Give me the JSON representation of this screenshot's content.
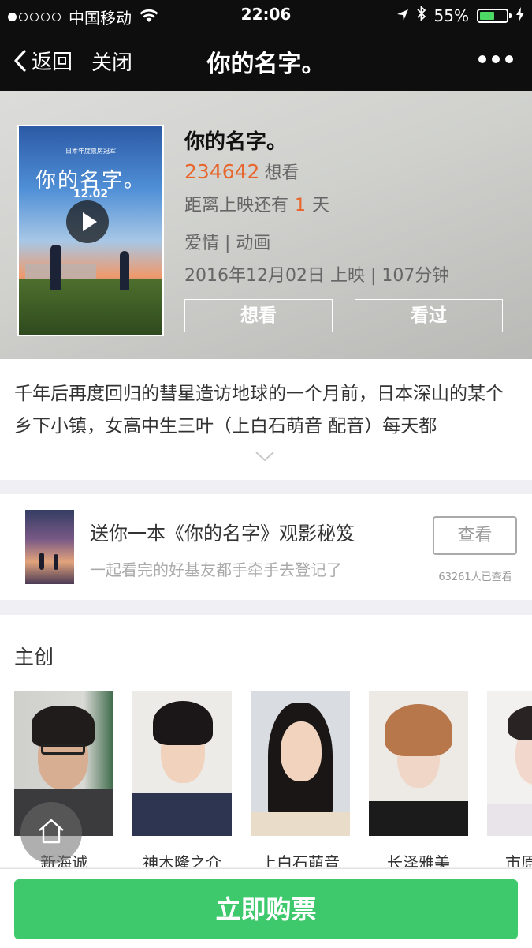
{
  "status_bar": {
    "carrier": "中国移动",
    "time": "22:06",
    "battery": "55%",
    "battery_level": 0.55,
    "signal_bars_filled": 1,
    "signal_bars_total": 5,
    "icons": [
      "wifi-icon",
      "location-arrow-icon",
      "bluetooth-icon",
      "battery-icon",
      "charging-bolt-icon"
    ]
  },
  "nav": {
    "back_label": "返回",
    "close_label": "关闭",
    "title": "你的名字。",
    "more_icon": "more-dots-icon"
  },
  "movie": {
    "title": "你的名字。",
    "wants_count": "234642",
    "wants_label": "想看",
    "release_prefix": "距离上映还有",
    "release_days": "1",
    "release_suffix": "天",
    "genre": "爱情 | 动画",
    "info": "2016年12月02日 上映 | 107分钟",
    "want_button": "想看",
    "seen_button": "看过",
    "poster": {
      "top_text": "日本年度票房冠军",
      "title": "你的名字。",
      "date": "12.02"
    }
  },
  "synopsis": {
    "text": "千年后再度回归的彗星造访地球的一个月前，日本深山的某个乡下小镇，女高中生三叶（上白石萌音 配音）每天都"
  },
  "promo": {
    "title": "送你一本《你的名字》观影秘笈",
    "subtitle": "一起看完的好基友都手牵手去登记了",
    "button": "查看",
    "count": "63261人已查看"
  },
  "cast": {
    "heading": "主创",
    "members": [
      {
        "name": "新海诚"
      },
      {
        "name": "神木隆之介"
      },
      {
        "name": "上白石萌音"
      },
      {
        "name": "长泽雅美"
      },
      {
        "name": "市原悦子"
      }
    ]
  },
  "buy_button": "立即购票",
  "colors": {
    "accent_orange": "#e8652b",
    "buy_green": "#3ec96c",
    "nav_bg": "#0e0e0e"
  }
}
